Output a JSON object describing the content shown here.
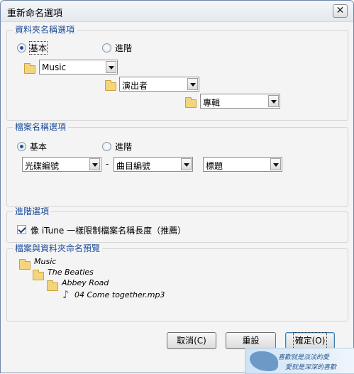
{
  "window": {
    "title": "重新命名選項",
    "close_glyph": "✕"
  },
  "folder_group": {
    "label": "資料夾名稱選項",
    "radio_basic": "基本",
    "radio_advanced": "進階",
    "selects": [
      "Music",
      "演出者",
      "專輯"
    ]
  },
  "file_group": {
    "label": "檔案名稱選項",
    "radio_basic": "基本",
    "radio_advanced": "進階",
    "selects": [
      "光碟編號",
      "曲目編號",
      "標題"
    ],
    "dash": "-"
  },
  "advanced_group": {
    "label": "進階選項",
    "checkbox_label": "像 iTune 一樣限制檔案名稱長度（推薦）",
    "checked": true
  },
  "preview_group": {
    "label": "檔案與資料夾命名預覽",
    "tree": [
      "Music",
      "The Beatles",
      "Abbey Road",
      "04 Come together.mp3"
    ],
    "note_glyph": "♪"
  },
  "buttons": {
    "cancel": "取消(C)",
    "reset": "重設",
    "ok": "確定(O)"
  },
  "watermark": {
    "line1": "喜歡就是淡淡的愛",
    "line2": "愛就是深深的喜歡"
  },
  "colors": {
    "group_label": "#1c4c9a",
    "folder": "#f4d57e",
    "accent": "#3c7fb1"
  }
}
